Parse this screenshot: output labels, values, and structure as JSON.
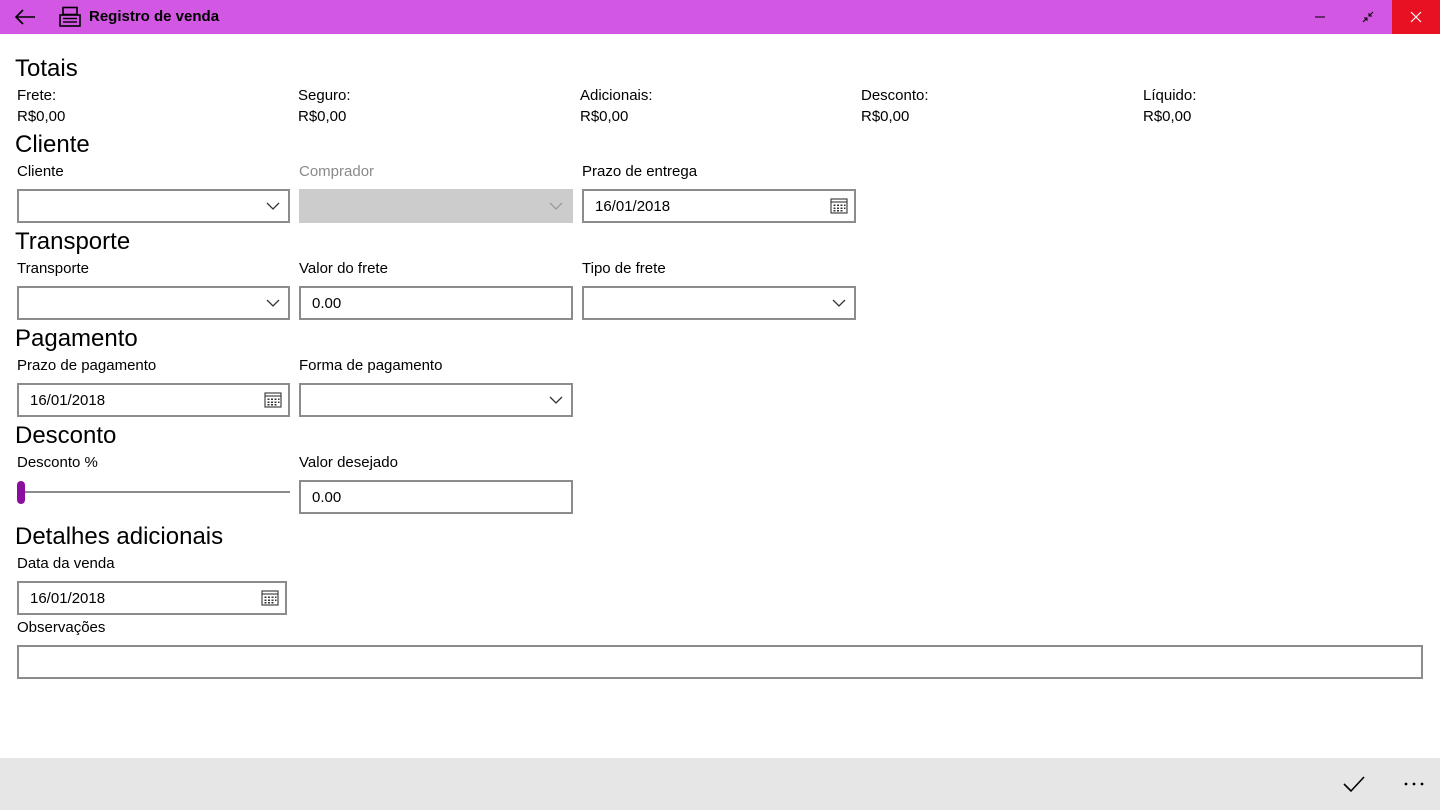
{
  "window": {
    "title": "Registro de venda",
    "accent": "#d257e2",
    "close_bg": "#e81123"
  },
  "totais": {
    "title": "Totais",
    "items": [
      {
        "label": "Frete:",
        "value": "R$0,00"
      },
      {
        "label": "Seguro:",
        "value": "R$0,00"
      },
      {
        "label": "Adicionais:",
        "value": "R$0,00"
      },
      {
        "label": "Desconto:",
        "value": "R$0,00"
      },
      {
        "label": "Líquido:",
        "value": "R$0,00"
      }
    ]
  },
  "cliente": {
    "title": "Cliente",
    "cliente_label": "Cliente",
    "cliente_value": "",
    "comprador_label": "Comprador",
    "comprador_value": "",
    "prazo_entrega_label": "Prazo de entrega",
    "prazo_entrega_value": "16/01/2018"
  },
  "transporte": {
    "title": "Transporte",
    "transporte_label": "Transporte",
    "transporte_value": "",
    "valor_frete_label": "Valor do frete",
    "valor_frete_value": "0.00",
    "tipo_frete_label": "Tipo de frete",
    "tipo_frete_value": ""
  },
  "pagamento": {
    "title": "Pagamento",
    "prazo_pagamento_label": "Prazo de pagamento",
    "prazo_pagamento_value": "16/01/2018",
    "forma_pagamento_label": "Forma de pagamento",
    "forma_pagamento_value": ""
  },
  "desconto": {
    "title": "Desconto",
    "percent_label": "Desconto %",
    "percent_value": 0,
    "slider_color": "#8a0f9e",
    "valor_desejado_label": "Valor desejado",
    "valor_desejado_value": "0.00"
  },
  "detalhes": {
    "title": "Detalhes adicionais",
    "data_venda_label": "Data da venda",
    "data_venda_value": "16/01/2018",
    "observacoes_label": "Observações",
    "observacoes_value": ""
  },
  "icons": {
    "back": "back-arrow-icon",
    "app": "cash-register-icon",
    "minimize": "minimize-icon",
    "restore": "restore-icon",
    "close": "close-icon",
    "calendar": "calendar-icon",
    "dropdown": "chevron-down-icon",
    "accept": "checkmark-icon",
    "more": "more-icon"
  }
}
